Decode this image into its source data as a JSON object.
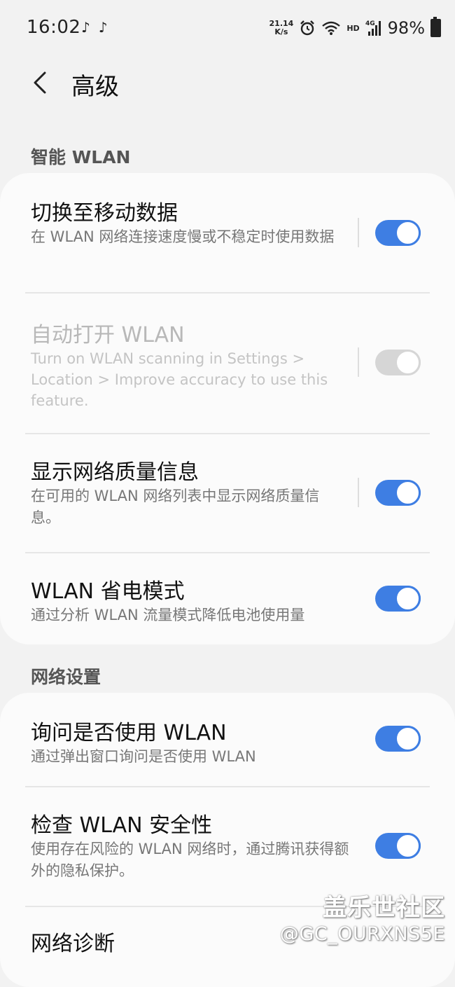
{
  "status_bar": {
    "time": "16:02",
    "app_icons": [
      "tiktok-icon",
      "tiktok-icon"
    ],
    "net_speed_value": "21.14",
    "net_speed_unit": "K/s",
    "hd_label": "HD",
    "network_label": "4G",
    "battery_text": "98%"
  },
  "header": {
    "title": "高级"
  },
  "sections": {
    "smart_wlan": "智能 WLAN",
    "network_settings": "网络设置"
  },
  "smart_wlan_items": [
    {
      "title": "切换至移动数据",
      "subtitle": "在 WLAN 网络连接速度慢或不稳定时使用数据",
      "toggle_on": true,
      "enabled": true
    },
    {
      "title": "自动打开 WLAN",
      "subtitle": "Turn on WLAN scanning in Settings > Location > Improve accuracy to use this feature.",
      "toggle_on": true,
      "enabled": false
    },
    {
      "title": "显示网络质量信息",
      "subtitle": "在可用的 WLAN 网络列表中显示网络质量信息。",
      "toggle_on": true,
      "enabled": true
    },
    {
      "title": "WLAN 省电模式",
      "subtitle": "通过分析 WLAN 流量模式降低电池使用量",
      "toggle_on": true,
      "enabled": true
    }
  ],
  "network_items": [
    {
      "title": "询问是否使用 WLAN",
      "subtitle": "通过弹出窗口询问是否使用 WLAN",
      "toggle_on": true
    },
    {
      "title": "检查 WLAN 安全性",
      "subtitle": "使用存在风险的 WLAN 网络时，通过腾讯获得额外的隐私保护。",
      "toggle_on": true
    },
    {
      "title": "网络诊断"
    }
  ],
  "watermark": {
    "line1": "盖乐世社区",
    "line2": "@GC_OURXNS5E"
  },
  "colors": {
    "accent": "#3e7ee3",
    "background": "#f2f2f2",
    "card": "#fbfbfb"
  }
}
